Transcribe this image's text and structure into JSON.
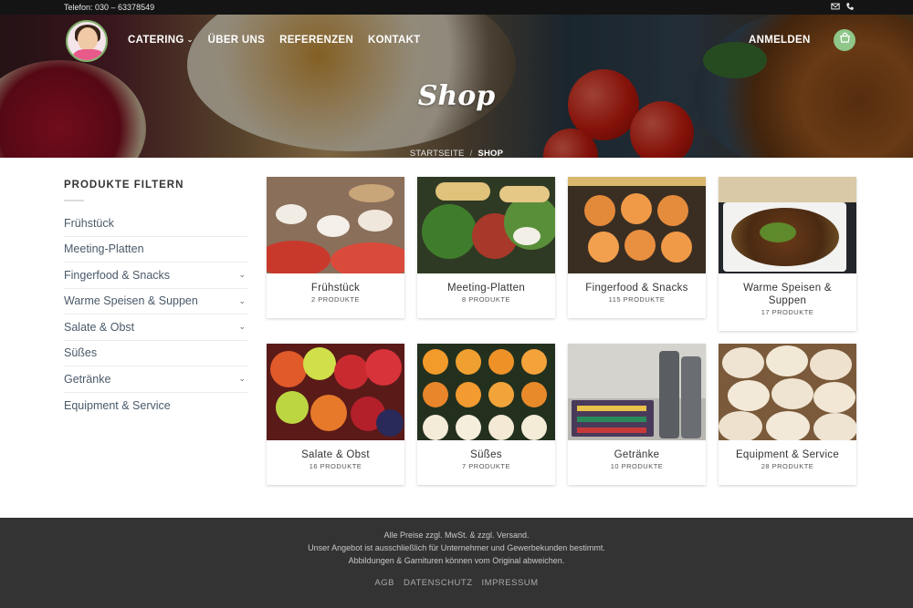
{
  "topbar": {
    "phone": "Telefon: 030 – 63378549",
    "icons": [
      "mail-icon",
      "phone-icon"
    ]
  },
  "header": {
    "nav": [
      {
        "label": "CATERING",
        "has_dropdown": true
      },
      {
        "label": "ÜBER UNS"
      },
      {
        "label": "REFERENZEN"
      },
      {
        "label": "KONTAKT"
      }
    ],
    "login_label": "ANMELDEN",
    "cart_icon": "basket-icon",
    "accent_color": "#8fc689"
  },
  "hero": {
    "title": "Shop",
    "breadcrumb": {
      "home": "STARTSEITE",
      "separator": "/",
      "current": "SHOP"
    }
  },
  "sidebar": {
    "title": "PRODUKTE FILTERN",
    "categories": [
      {
        "label": "Frühstück",
        "expandable": false
      },
      {
        "label": "Meeting-Platten",
        "expandable": false
      },
      {
        "label": "Fingerfood & Snacks",
        "expandable": true
      },
      {
        "label": "Warme Speisen & Suppen",
        "expandable": true
      },
      {
        "label": "Salate & Obst",
        "expandable": true
      },
      {
        "label": "Süßes",
        "expandable": false
      },
      {
        "label": "Getränke",
        "expandable": true
      },
      {
        "label": "Equipment & Service",
        "expandable": false
      }
    ]
  },
  "products": [
    {
      "name": "Frühstück",
      "count": "2 PRODUKTE"
    },
    {
      "name": "Meeting-Platten",
      "count": "8 PRODUKTE"
    },
    {
      "name": "Fingerfood & Snacks",
      "count": "115 PRODUKTE"
    },
    {
      "name": "Warme Speisen & Suppen",
      "count": "17 PRODUKTE"
    },
    {
      "name": "Salate & Obst",
      "count": "16 PRODUKTE"
    },
    {
      "name": "Süßes",
      "count": "7 PRODUKTE"
    },
    {
      "name": "Getränke",
      "count": "10 PRODUKTE"
    },
    {
      "name": "Equipment & Service",
      "count": "28 PRODUKTE"
    }
  ],
  "footer": {
    "lines": [
      "Alle Preise zzgl. MwSt. & zzgl. Versand.",
      "Unser Angebot ist ausschließlich für Unternehmer und Gewerbekunden bestimmt.",
      "Abbildungen & Garnituren können vom Original abweichen."
    ],
    "links": [
      "AGB",
      "DATENSCHUTZ",
      "IMPRESSUM"
    ]
  }
}
